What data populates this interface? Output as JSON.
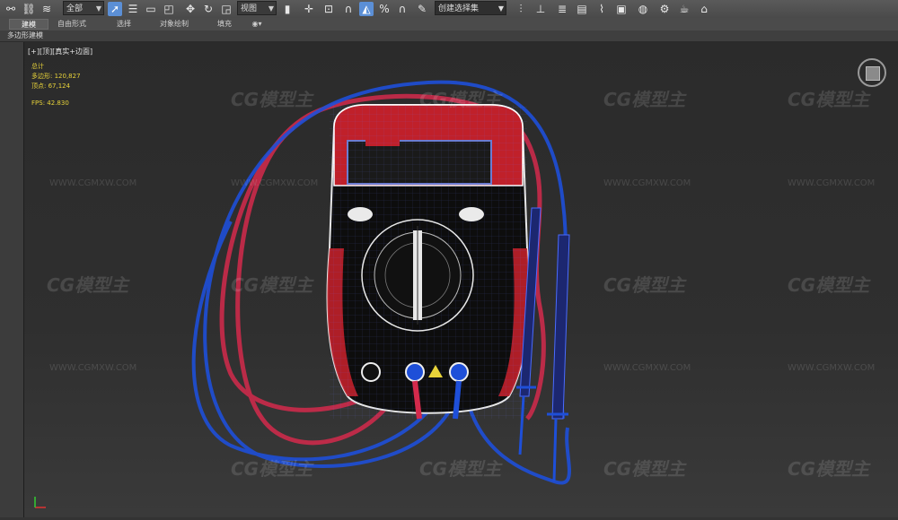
{
  "toolbar": {
    "selection_filter": "全部",
    "ref_coord": "视图",
    "named_selection_placeholder": "创建选择集",
    "icons": [
      "link-icon",
      "unlink-icon",
      "bind-space-warp-icon",
      "select-object-icon",
      "rect-select-region-icon",
      "window-crossing-icon",
      "select-move-icon",
      "select-rotate-icon",
      "select-scale-icon",
      "select-place-icon",
      "snap-toggle-icon",
      "angle-snap-icon",
      "percent-snap-icon",
      "spinner-snap-icon",
      "edit-named-selection-icon",
      "mirror-icon",
      "align-icon",
      "layer-explorer-icon",
      "graphite-toolbar-icon",
      "curve-editor-icon",
      "schematic-view-icon",
      "material-editor-icon",
      "render-setup-icon",
      "rendered-frame-icon",
      "render-production-icon"
    ]
  },
  "ribbon": {
    "tabs": [
      "建模",
      "自由形式",
      "选择",
      "对象绘制",
      "填充"
    ],
    "active_tab": "建模",
    "sub_label": "多边形建模"
  },
  "viewport": {
    "label": "[+][顶][真实+边面]",
    "stats": {
      "header": "总计",
      "polys_label": "多边形:",
      "polys_value": "120,827",
      "verts_label": "顶点:",
      "verts_value": "67,124",
      "fps_label": "FPS:",
      "fps_value": "42.830"
    },
    "watermark_brand": "CG模型主",
    "watermark_url": "WWW.CGMXW.COM"
  },
  "colors": {
    "wire_blue": "#1e4fd8",
    "wire_red": "#d42a4c",
    "stat_yellow": "#e8d33a",
    "active_blue": "#5b8fd6"
  }
}
